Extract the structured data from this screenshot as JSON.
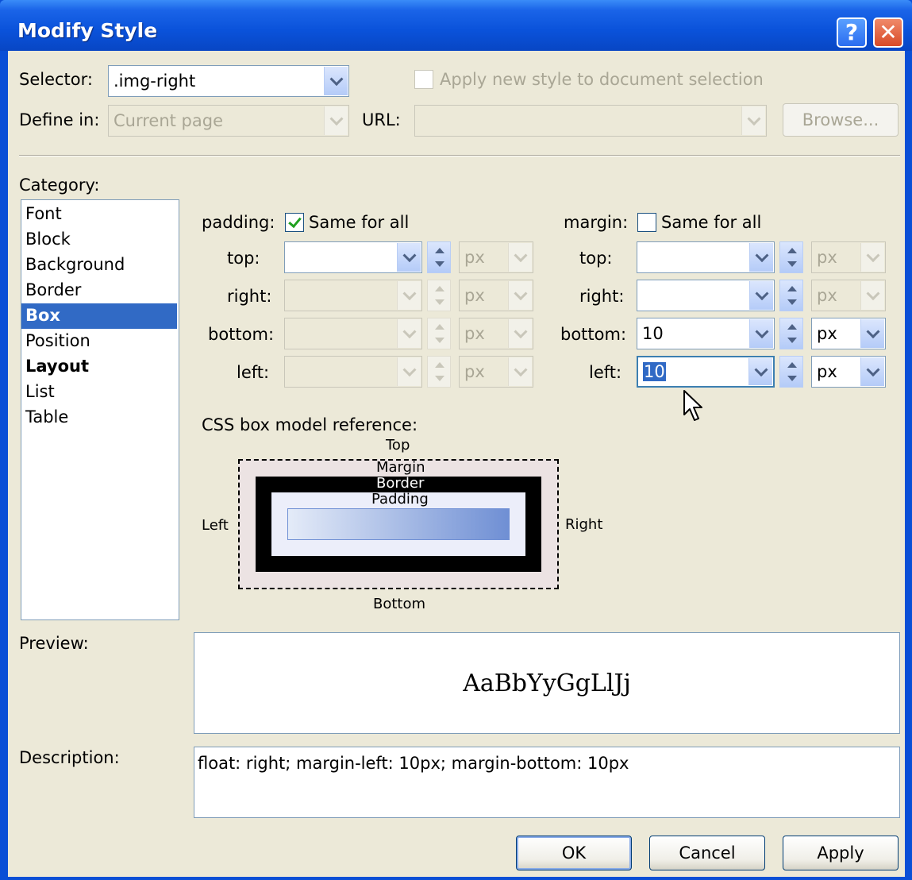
{
  "window": {
    "title": "Modify Style"
  },
  "selector": {
    "label": "Selector:",
    "value": ".img-right"
  },
  "apply_new_style": {
    "label": "Apply new style to document selection",
    "checked": false
  },
  "define_in": {
    "label": "Define in:",
    "value": "Current page"
  },
  "url": {
    "label": "URL:",
    "value": ""
  },
  "browse_label": "Browse...",
  "category": {
    "label": "Category:",
    "items": [
      "Font",
      "Block",
      "Background",
      "Border",
      "Box",
      "Position",
      "Layout",
      "List",
      "Table"
    ],
    "selected": "Box"
  },
  "padding": {
    "label": "padding:",
    "same_for_all_label": "Same for all",
    "same_for_all": true,
    "fields": [
      {
        "label": "top:",
        "value": "",
        "unit": "px"
      },
      {
        "label": "right:",
        "value": "",
        "unit": "px"
      },
      {
        "label": "bottom:",
        "value": "",
        "unit": "px"
      },
      {
        "label": "left:",
        "value": "",
        "unit": "px"
      }
    ]
  },
  "margin": {
    "label": "margin:",
    "same_for_all_label": "Same for all",
    "same_for_all": false,
    "fields": [
      {
        "label": "top:",
        "value": "",
        "unit": "px"
      },
      {
        "label": "right:",
        "value": "",
        "unit": "px"
      },
      {
        "label": "bottom:",
        "value": "10",
        "unit": "px"
      },
      {
        "label": "left:",
        "value": "10",
        "unit": "px"
      }
    ]
  },
  "box_model": {
    "title": "CSS box model reference:",
    "top": "Top",
    "bottom": "Bottom",
    "left": "Left",
    "right": "Right",
    "margin": "Margin",
    "border": "Border",
    "padding": "Padding"
  },
  "preview": {
    "label": "Preview:",
    "sample": "AaBbYyGgLlJj"
  },
  "description": {
    "label": "Description:",
    "text": "float: right; margin-left: 10px; margin-bottom: 10px"
  },
  "buttons": {
    "ok": "OK",
    "cancel": "Cancel",
    "apply": "Apply"
  },
  "colors": {
    "titlebar": "#0a52da",
    "face": "#ece9d8",
    "selection": "#316ac5",
    "field_border": "#7f9db9"
  }
}
